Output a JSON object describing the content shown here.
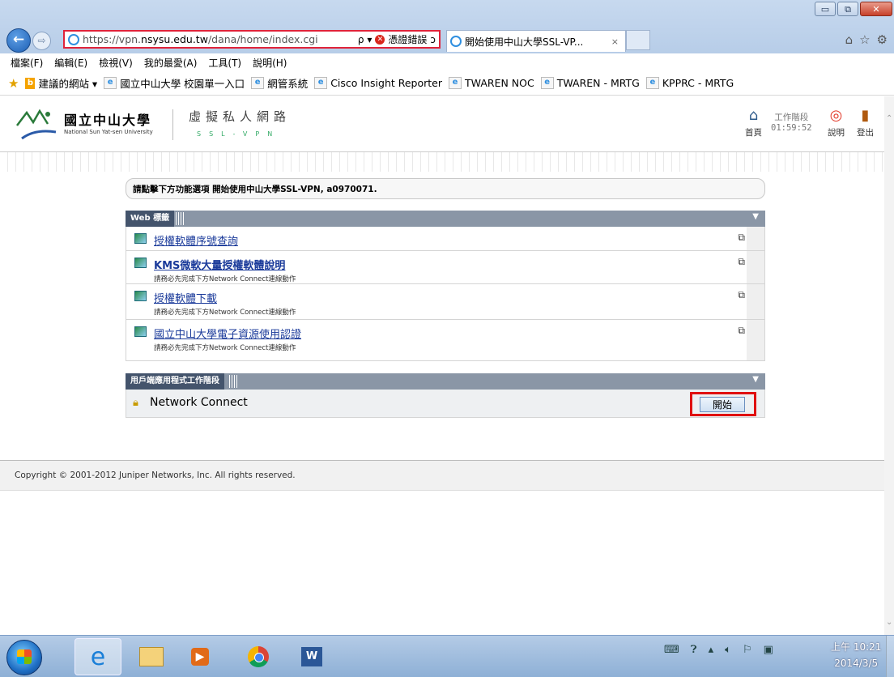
{
  "browser": {
    "url_prefix": "https://vpn.",
    "url_domain": "nsysu.edu.tw",
    "url_path": "/dana/home/index.cgi",
    "search_glyph": "ρ ▾",
    "cert_error": "憑證錯誤",
    "refresh_glyph": "ↄ",
    "tab_title": "開始使用中山大學SSL-VP...",
    "tab_close": "×",
    "back_glyph": "←",
    "forward_glyph": "⇨",
    "home_glyph": "⌂",
    "favorites_glyph": "☆",
    "settings_glyph": "⚙",
    "window_min": "▭",
    "window_max": "⧉",
    "window_close": "✕"
  },
  "menu": [
    "檔案(F)",
    "編輯(E)",
    "檢視(V)",
    "我的最愛(A)",
    "工具(T)",
    "說明(H)"
  ],
  "favorites": {
    "suggested": "建議的網站 ▾",
    "items": [
      "國立中山大學 校園單一入口",
      "網管系統",
      "Cisco Insight Reporter",
      "TWAREN NOC",
      "TWAREN - MRTG",
      "KPPRC - MRTG"
    ]
  },
  "site_header": {
    "logo_zh": "國立中山大學",
    "logo_en": "National Sun Yat-sen University",
    "vpn_zh": "虛擬私人網路",
    "vpn_en": "SSL-VPN",
    "home_label": "首頁",
    "session_label": "工作階段",
    "session_time": "01:59:52",
    "help_label": "說明",
    "logout_label": "登出"
  },
  "welcome": "請點擊下方功能選項 開始使用中山大學SSL-VPN, a0970071.",
  "web_section": {
    "title": "Web 標籤",
    "bookmarks": [
      {
        "label": "授權軟體序號查詢",
        "note": ""
      },
      {
        "label": "KMS微軟大量授權軟體說明",
        "note": "請務必先完成下方Network Connect連線動作"
      },
      {
        "label": "授權軟體下載",
        "note": "請務必先完成下方Network Connect連線動作"
      },
      {
        "label": "國立中山大學電子資源使用認證",
        "note": "請務必先完成下方Network Connect連線動作"
      }
    ]
  },
  "client_section": {
    "title": "用戶端應用程式工作階段",
    "app_label": "Network Connect",
    "start_label": "開始"
  },
  "footer": {
    "copyright": "Copyright © 2001-2012 Juniper Networks, Inc. All rights reserved."
  },
  "taskbar": {
    "word_label": "W",
    "clock_time": "上午 10:21",
    "clock_date": "2014/3/5"
  },
  "colors": {
    "highlight_box": "#e01010",
    "link": "#1a3a9a",
    "section_header": "#44546c"
  }
}
